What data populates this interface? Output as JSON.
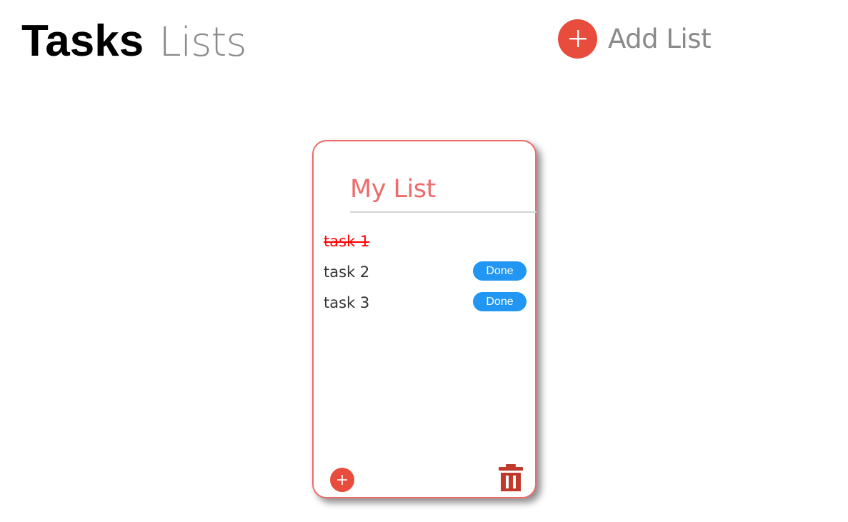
{
  "header": {
    "title_bold": "Tasks",
    "title_light": "Lists",
    "add_list_label": "Add List"
  },
  "colors": {
    "accent": "#e74c3c",
    "card_border": "#ee6b6b",
    "done_button": "#2196f3",
    "completed_task": "#ff0000",
    "trash": "#c0392b"
  },
  "icons": {
    "add_list": "plus-icon",
    "card_add": "plus-icon",
    "card_delete": "trash-icon"
  },
  "list": {
    "title": "My List",
    "tasks": [
      {
        "label": "task 1",
        "completed": true,
        "button_label": ""
      },
      {
        "label": "task 2",
        "completed": false,
        "button_label": "Done"
      },
      {
        "label": "task 3",
        "completed": false,
        "button_label": "Done"
      }
    ]
  }
}
